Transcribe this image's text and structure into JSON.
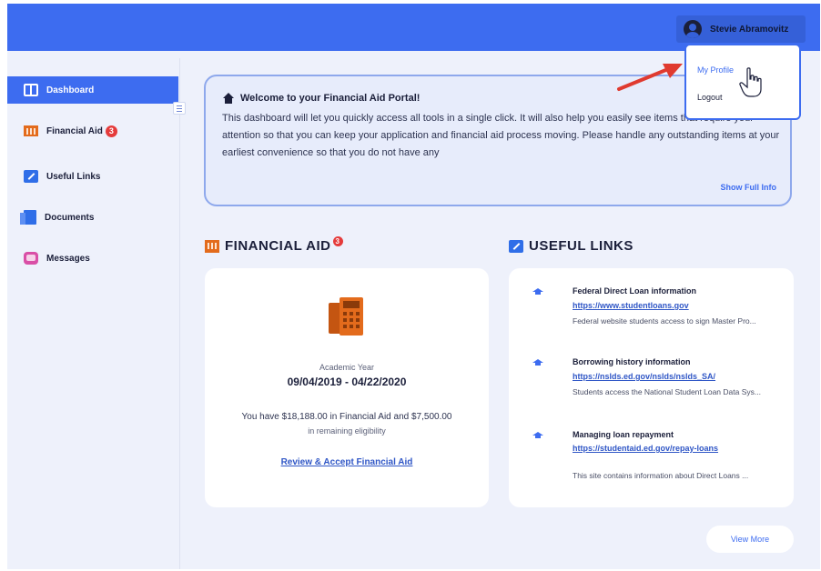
{
  "header": {
    "user_name": "Stevie Abramovitz",
    "accent": "#3d6cf0"
  },
  "user_menu": {
    "items": [
      {
        "label": "My Profile"
      },
      {
        "label": "Logout"
      }
    ]
  },
  "sidebar": {
    "items": [
      {
        "label": "Dashboard",
        "icon": "dashboard-icon",
        "active": true
      },
      {
        "label": "Financial Aid",
        "icon": "bank-icon",
        "badge": "3"
      },
      {
        "label": "Useful Links",
        "icon": "link-icon"
      },
      {
        "label": "Documents",
        "icon": "documents-icon"
      },
      {
        "label": "Messages",
        "icon": "messages-icon"
      }
    ]
  },
  "welcome": {
    "title": "Welcome to your Financial Aid Portal!",
    "body": "This dashboard will let you quickly access all tools in a single click. It will also help you easily see items that require your attention so that you can keep your application and financial aid process moving. Please handle any outstanding items at your earliest convenience so that you do not have any",
    "show_full": "Show Full Info"
  },
  "financial_aid": {
    "heading": "FINANCIAL AID",
    "badge": "3",
    "academic_year_label": "Academic Year",
    "academic_year": "09/04/2019 - 04/22/2020",
    "summary": "You have $18,188.00 in Financial Aid and $7,500.00",
    "remaining": "in remaining eligibility",
    "review_link": "Review & Accept Financial Aid"
  },
  "useful_links": {
    "heading": "USEFUL LINKS",
    "items": [
      {
        "title": "Federal Direct Loan information",
        "url": "https://www.studentloans.gov",
        "desc": "Federal website students access to sign Master Pro..."
      },
      {
        "title": "Borrowing history information",
        "url": "https://nslds.ed.gov/nslds/nslds_SA/",
        "desc": "Students access the National Student Loan Data Sys..."
      },
      {
        "title": "Managing loan repayment",
        "url": "https://studentaid.ed.gov/repay-loans",
        "desc": "This site contains information about Direct Loans ..."
      }
    ],
    "view_more": "View More"
  }
}
